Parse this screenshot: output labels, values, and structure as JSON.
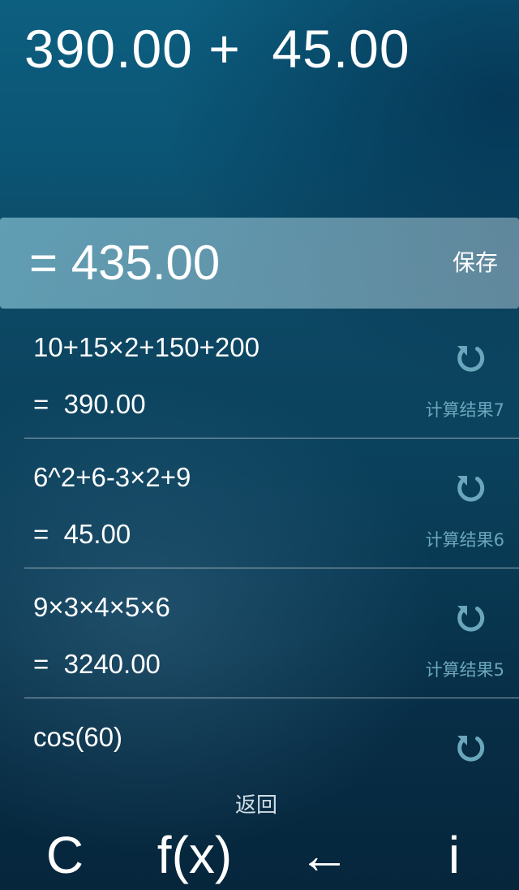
{
  "display": {
    "expression": "390.00 +  45.00",
    "result": "= 435.00",
    "save_label": "保存"
  },
  "history": [
    {
      "expression": "10+15×2+150+200",
      "result": "=  390.00",
      "label": "计算结果7",
      "restore_icon": "restore-icon"
    },
    {
      "expression": "6^2+6-3×2+9",
      "result": "=  45.00",
      "label": "计算结果6",
      "restore_icon": "restore-icon"
    },
    {
      "expression": "9×3×4×5×6",
      "result": "=  3240.00",
      "label": "计算结果5",
      "restore_icon": "restore-icon"
    },
    {
      "expression": "cos(60)",
      "restore_icon": "restore-icon"
    }
  ],
  "back_label": "返回",
  "keys": {
    "clear": "C",
    "function": "f(x)",
    "backspace": "←",
    "info": "i"
  },
  "colors": {
    "accent_icon": "#6aa6bc",
    "result_bar": "#86b4c6",
    "background_top": "#0d5f80",
    "background_bottom": "#06263c"
  }
}
